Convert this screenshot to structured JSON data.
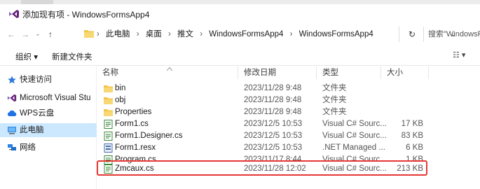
{
  "window": {
    "title": "添加现有项 - WindowsFormsApp4"
  },
  "nav": {
    "back_glyph": "←",
    "forward_glyph": "→",
    "recent_glyph": "⌄",
    "up_glyph": "↑",
    "breadcrumbs": [
      "此电脑",
      "桌面",
      "推文",
      "WindowsFormsApp4",
      "WindowsFormsApp4"
    ],
    "separator": "›",
    "dropdown_glyph": "⌄",
    "refresh_glyph": "↻",
    "search_placeholder": "搜索\"WindowsFormsA"
  },
  "toolbar": {
    "organize_label": "组织 ▾",
    "new_folder_label": "新建文件夹",
    "view_label": "☷ ▾"
  },
  "sidebar": {
    "items": [
      {
        "label": "快速访问",
        "icon": "star-icon"
      },
      {
        "label": "Microsoft Visual Stu",
        "icon": "visual-studio-icon"
      },
      {
        "label": "WPS云盘",
        "icon": "cloud-icon"
      },
      {
        "label": "此电脑",
        "icon": "computer-icon",
        "selected": true
      },
      {
        "label": "网络",
        "icon": "network-icon"
      }
    ]
  },
  "columns": {
    "name": "名称",
    "date": "修改日期",
    "type": "类型",
    "size": "大小"
  },
  "files": [
    {
      "name": "bin",
      "date": "2023/11/28 9:48",
      "type": "文件夹",
      "size": "",
      "icon": "folder-icon"
    },
    {
      "name": "obj",
      "date": "2023/11/28 9:48",
      "type": "文件夹",
      "size": "",
      "icon": "folder-icon"
    },
    {
      "name": "Properties",
      "date": "2023/11/28 9:48",
      "type": "文件夹",
      "size": "",
      "icon": "folder-icon"
    },
    {
      "name": "Form1.cs",
      "date": "2023/12/5 10:53",
      "type": "Visual C# Sourc...",
      "size": "17 KB",
      "icon": "csharp-file-icon"
    },
    {
      "name": "Form1.Designer.cs",
      "date": "2023/12/5 10:53",
      "type": "Visual C# Sourc...",
      "size": "83 KB",
      "icon": "csharp-file-icon"
    },
    {
      "name": "Form1.resx",
      "date": "2023/12/5 10:53",
      "type": ".NET Managed ...",
      "size": "6 KB",
      "icon": "resx-file-icon"
    },
    {
      "name": "Program.cs",
      "date": "2023/11/17 8:44",
      "type": "Visual C# Sourc...",
      "size": "1 KB",
      "icon": "csharp-file-icon"
    },
    {
      "name": "Zmcaux.cs",
      "date": "2023/11/28 12:02",
      "type": "Visual C# Sourc...",
      "size": "213 KB",
      "icon": "csharp-file-icon",
      "highlighted": true
    }
  ],
  "colors": {
    "selection": "#cce8ff",
    "highlight_border": "#e53935",
    "folder": "#f3c447",
    "vs_purple": "#8661c5"
  }
}
